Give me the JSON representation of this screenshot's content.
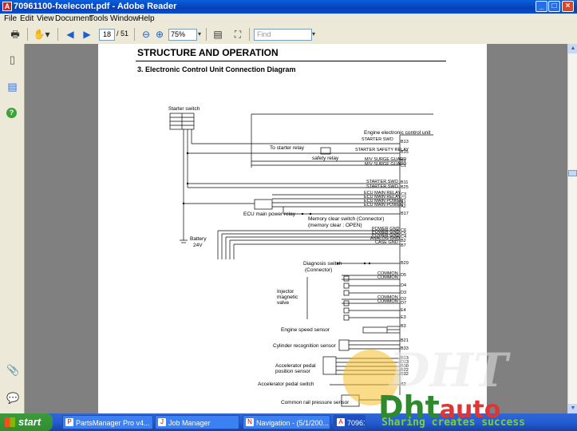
{
  "window": {
    "title": "70961100-fxelecont.pdf - Adobe Reader"
  },
  "menu": [
    "File",
    "Edit",
    "View",
    "Document",
    "Tools",
    "Window",
    "Help"
  ],
  "toolbar": {
    "page_current": "18",
    "page_total": "/ 51",
    "zoom": "75%",
    "find_placeholder": "Find"
  },
  "doc": {
    "heading": "STRUCTURE AND OPERATION",
    "subheading": "3.  Electronic Control Unit Connection Diagram",
    "labels": {
      "starter_switch": "Starter switch",
      "ecu": "Engine electronic control unit",
      "to_starter_relay": "To starter relay",
      "safety_relay": "safety relay",
      "ecu_main_power_relay": "ECU main power relay",
      "memory_clear_switch": "Memory clear switch (Connector)",
      "memory_clear_open": "(memory clear : OPEN)",
      "battery": "Battery",
      "battery_v": "24V",
      "diagnosis_switch": "Diagnosis switch",
      "diagnosis_connector": "(Connector)",
      "injector": "Injector",
      "magnetic": "magnetic",
      "valve": "valve",
      "engine_speed_sensor": "Engine speed sensor",
      "cylinder_recognition_sensor": "Cylinder recognition sensor",
      "accelerator_pedal": "Accelerator pedal",
      "position_sensor": "position sensor",
      "accelerator_pedal_switch": "Accelerator pedal switch",
      "common_rail_pressure_sensor": "Common rail pressure sensor"
    },
    "pins": [
      "B13",
      "B15",
      "B1",
      "C1",
      "B11",
      "B25",
      "C3",
      "C2",
      "A1",
      "A2",
      "B17",
      "C6",
      "C5",
      "C4",
      "B2",
      "B7",
      "B29",
      "D5",
      "D4",
      "D3",
      "D2",
      "D7",
      "E4",
      "E3",
      "B3",
      "B21",
      "B33",
      "B23",
      "D13",
      "B30",
      "B22",
      "B32",
      "B2"
    ],
    "ecu_signals": [
      "STARTER SWO",
      "STARTER SAFETY RELAY",
      "M/V SURGE GUARD",
      "M/V SURGE GUARD",
      "STARTER SWO",
      "STARTER SWO",
      "ECU MAIN RELAY",
      "ECU MAIN RELAY",
      "ECU MAIN POWER",
      "ECU MAIN POWER",
      "POWER GND",
      "POWER GND",
      "POWER GND",
      "ANALOG GND",
      "CASE GND",
      "COMMON",
      "COMMON",
      "COMMON",
      "COMMON"
    ]
  },
  "taskbar": {
    "start": "start",
    "tasks": [
      "PartsManager Pro v4...",
      "Job Manager",
      "Navigation - (5/1/200...",
      "70961..."
    ]
  },
  "watermark": {
    "brand1": "DHT",
    "brand2": "Dht",
    "brand3": "auto",
    "tagline": "Sharing creates success"
  },
  "colors": {
    "titlebar": "#0a4fd0",
    "taskbar": "#245dd3",
    "start": "#2f8f2f",
    "chrome": "#ece9d8"
  }
}
